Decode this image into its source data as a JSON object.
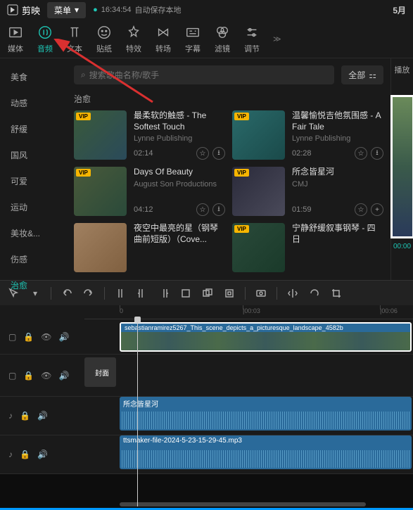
{
  "header": {
    "app_name": "剪映",
    "menu_label": "菜单",
    "autosave_time": "16:34:54",
    "autosave_text": "自动保存本地",
    "date": "5月"
  },
  "top_tabs": [
    {
      "label": "媒体",
      "id": "media"
    },
    {
      "label": "音频",
      "id": "audio"
    },
    {
      "label": "文本",
      "id": "text"
    },
    {
      "label": "贴纸",
      "id": "sticker"
    },
    {
      "label": "特效",
      "id": "effect"
    },
    {
      "label": "转场",
      "id": "transition"
    },
    {
      "label": "字幕",
      "id": "subtitle"
    },
    {
      "label": "滤镜",
      "id": "filter"
    },
    {
      "label": "调节",
      "id": "adjust"
    }
  ],
  "sidebar": {
    "items": [
      {
        "label": "美食"
      },
      {
        "label": "动感"
      },
      {
        "label": "舒缓"
      },
      {
        "label": "国风"
      },
      {
        "label": "可爱"
      },
      {
        "label": "运动"
      },
      {
        "label": "美妆&..."
      },
      {
        "label": "伤感"
      },
      {
        "label": "治愈"
      }
    ]
  },
  "search": {
    "placeholder": "搜索歌曲名称/歌手"
  },
  "filter": {
    "label": "全部"
  },
  "section_title": "治愈",
  "tracks": [
    {
      "title": "最柔软的触感 - The Softest Touch",
      "artist": "Lynne Publishing",
      "duration": "02:14"
    },
    {
      "title": "温馨愉悦吉他氛围感 - A Fair Tale",
      "artist": "Lynne Publishing",
      "duration": "02:28"
    },
    {
      "title": "Days Of Beauty",
      "artist": "August Son Productions",
      "duration": "04:12"
    },
    {
      "title": "所念皆星河",
      "artist": "CMJ",
      "duration": "01:59"
    },
    {
      "title": "夜空中最亮的星（钢琴曲前短版）（Cove...",
      "artist": "",
      "duration": ""
    },
    {
      "title": "宁静舒缓叙事钢琴 - 四日",
      "artist": "",
      "duration": ""
    }
  ],
  "preview": {
    "label": "播放",
    "time": "00:00"
  },
  "timeline": {
    "ticks": [
      "0",
      "|00:03",
      "|00:06"
    ],
    "video_clip_label": "sebastianramirez5267_This_scene_depicts_a_picturesque_landscape_4582b",
    "cover_label": "封面",
    "audio1_label": "所念皆星河",
    "audio2_label": "ttsmaker-file-2024-5-23-15-29-45.mp3"
  }
}
